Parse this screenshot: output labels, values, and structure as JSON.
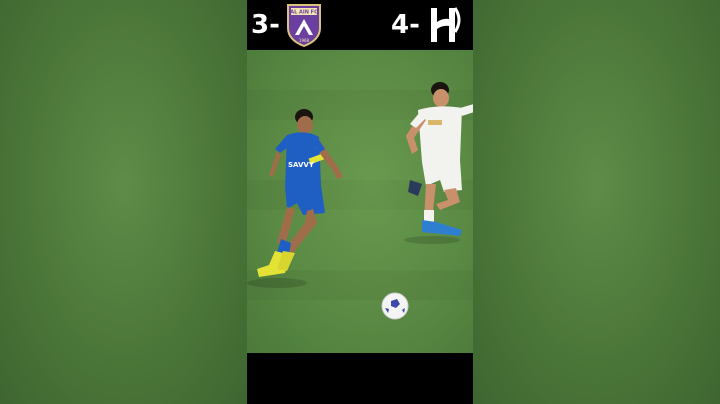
{
  "scoreboard": {
    "left_score": "3-",
    "right_score": "4-",
    "left_crest": "al-ain-fc-crest",
    "right_crest": "al-hilal-crest",
    "left_crest_text": "AL AIN FC",
    "left_crest_year": "1968"
  },
  "players": {
    "blue_player_sponsor": "SAVVY"
  },
  "colors": {
    "pitch": "#5a8a44",
    "blue_kit": "#1f5fc4",
    "white_kit": "#f2f2ee",
    "al_ain_purple": "#6b3fa0",
    "boots": "#e5e236"
  }
}
